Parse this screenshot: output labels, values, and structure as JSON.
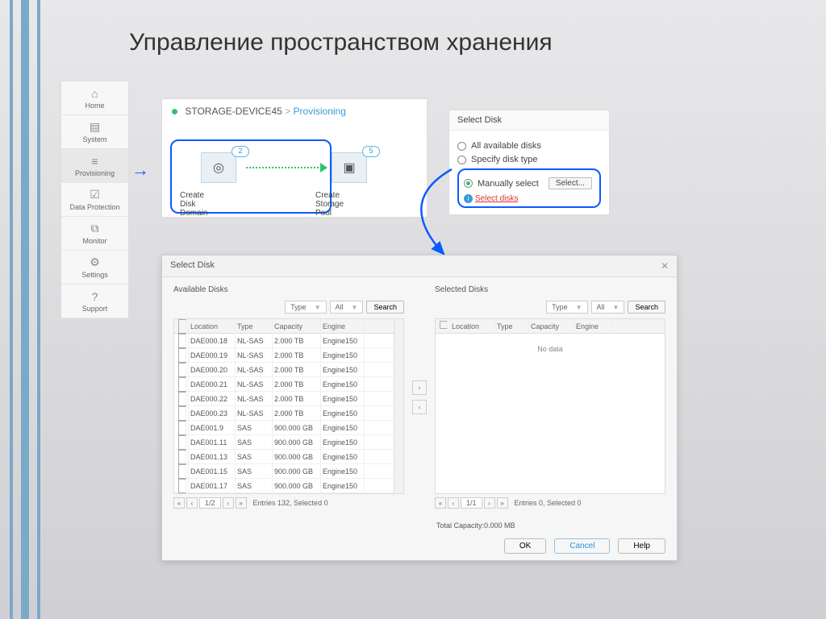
{
  "title": "Управление пространством хранения",
  "sidebar": [
    {
      "label": "Home",
      "icon": "⌂"
    },
    {
      "label": "System",
      "icon": "▤"
    },
    {
      "label": "Provisioning",
      "icon": "≡",
      "active": true
    },
    {
      "label": "Data Protection",
      "icon": "☑"
    },
    {
      "label": "Monitor",
      "icon": "⧉"
    },
    {
      "label": "Settings",
      "icon": "⚙"
    },
    {
      "label": "Support",
      "icon": "?"
    }
  ],
  "breadcrumb": {
    "device": "STORAGE-DEVICE45",
    "page": "Provisioning"
  },
  "cards": {
    "c1": {
      "label": "Create Disk Domain",
      "badge": "2"
    },
    "c2": {
      "label": "Create Storage Pool",
      "badge": "5"
    }
  },
  "select_panel": {
    "title": "Select Disk",
    "opt1": "All available disks",
    "opt2": "Specify disk type",
    "opt3": "Manually select",
    "select_btn": "Select...",
    "alert": "Select disks"
  },
  "dialog": {
    "title": "Select Disk",
    "left_title": "Available Disks",
    "right_title": "Selected Disks",
    "type_label": "Type",
    "all_label": "All",
    "search": "Search",
    "cols": [
      "Location",
      "Type",
      "Capacity",
      "Engine"
    ],
    "rows": [
      {
        "loc": "DAE000.18",
        "type": "NL-SAS",
        "cap": "2.000 TB",
        "eng": "Engine150"
      },
      {
        "loc": "DAE000.19",
        "type": "NL-SAS",
        "cap": "2.000 TB",
        "eng": "Engine150"
      },
      {
        "loc": "DAE000.20",
        "type": "NL-SAS",
        "cap": "2.000 TB",
        "eng": "Engine150"
      },
      {
        "loc": "DAE000.21",
        "type": "NL-SAS",
        "cap": "2.000 TB",
        "eng": "Engine150"
      },
      {
        "loc": "DAE000.22",
        "type": "NL-SAS",
        "cap": "2.000 TB",
        "eng": "Engine150"
      },
      {
        "loc": "DAE000.23",
        "type": "NL-SAS",
        "cap": "2.000 TB",
        "eng": "Engine150"
      },
      {
        "loc": "DAE001.9",
        "type": "SAS",
        "cap": "900.000 GB",
        "eng": "Engine150"
      },
      {
        "loc": "DAE001.11",
        "type": "SAS",
        "cap": "900.000 GB",
        "eng": "Engine150"
      },
      {
        "loc": "DAE001.13",
        "type": "SAS",
        "cap": "900.000 GB",
        "eng": "Engine150"
      },
      {
        "loc": "DAE001.15",
        "type": "SAS",
        "cap": "900.000 GB",
        "eng": "Engine150"
      },
      {
        "loc": "DAE001.17",
        "type": "SAS",
        "cap": "900.000 GB",
        "eng": "Engine150"
      }
    ],
    "no_data": "No data",
    "pager_left": {
      "page": "1/2",
      "status": "Entries 132, Selected 0"
    },
    "pager_right": {
      "page": "1/1",
      "status": "Entries 0, Selected 0"
    },
    "total": "Total Capacity:0.000 MB",
    "ok": "OK",
    "cancel": "Cancel",
    "help": "Help"
  }
}
